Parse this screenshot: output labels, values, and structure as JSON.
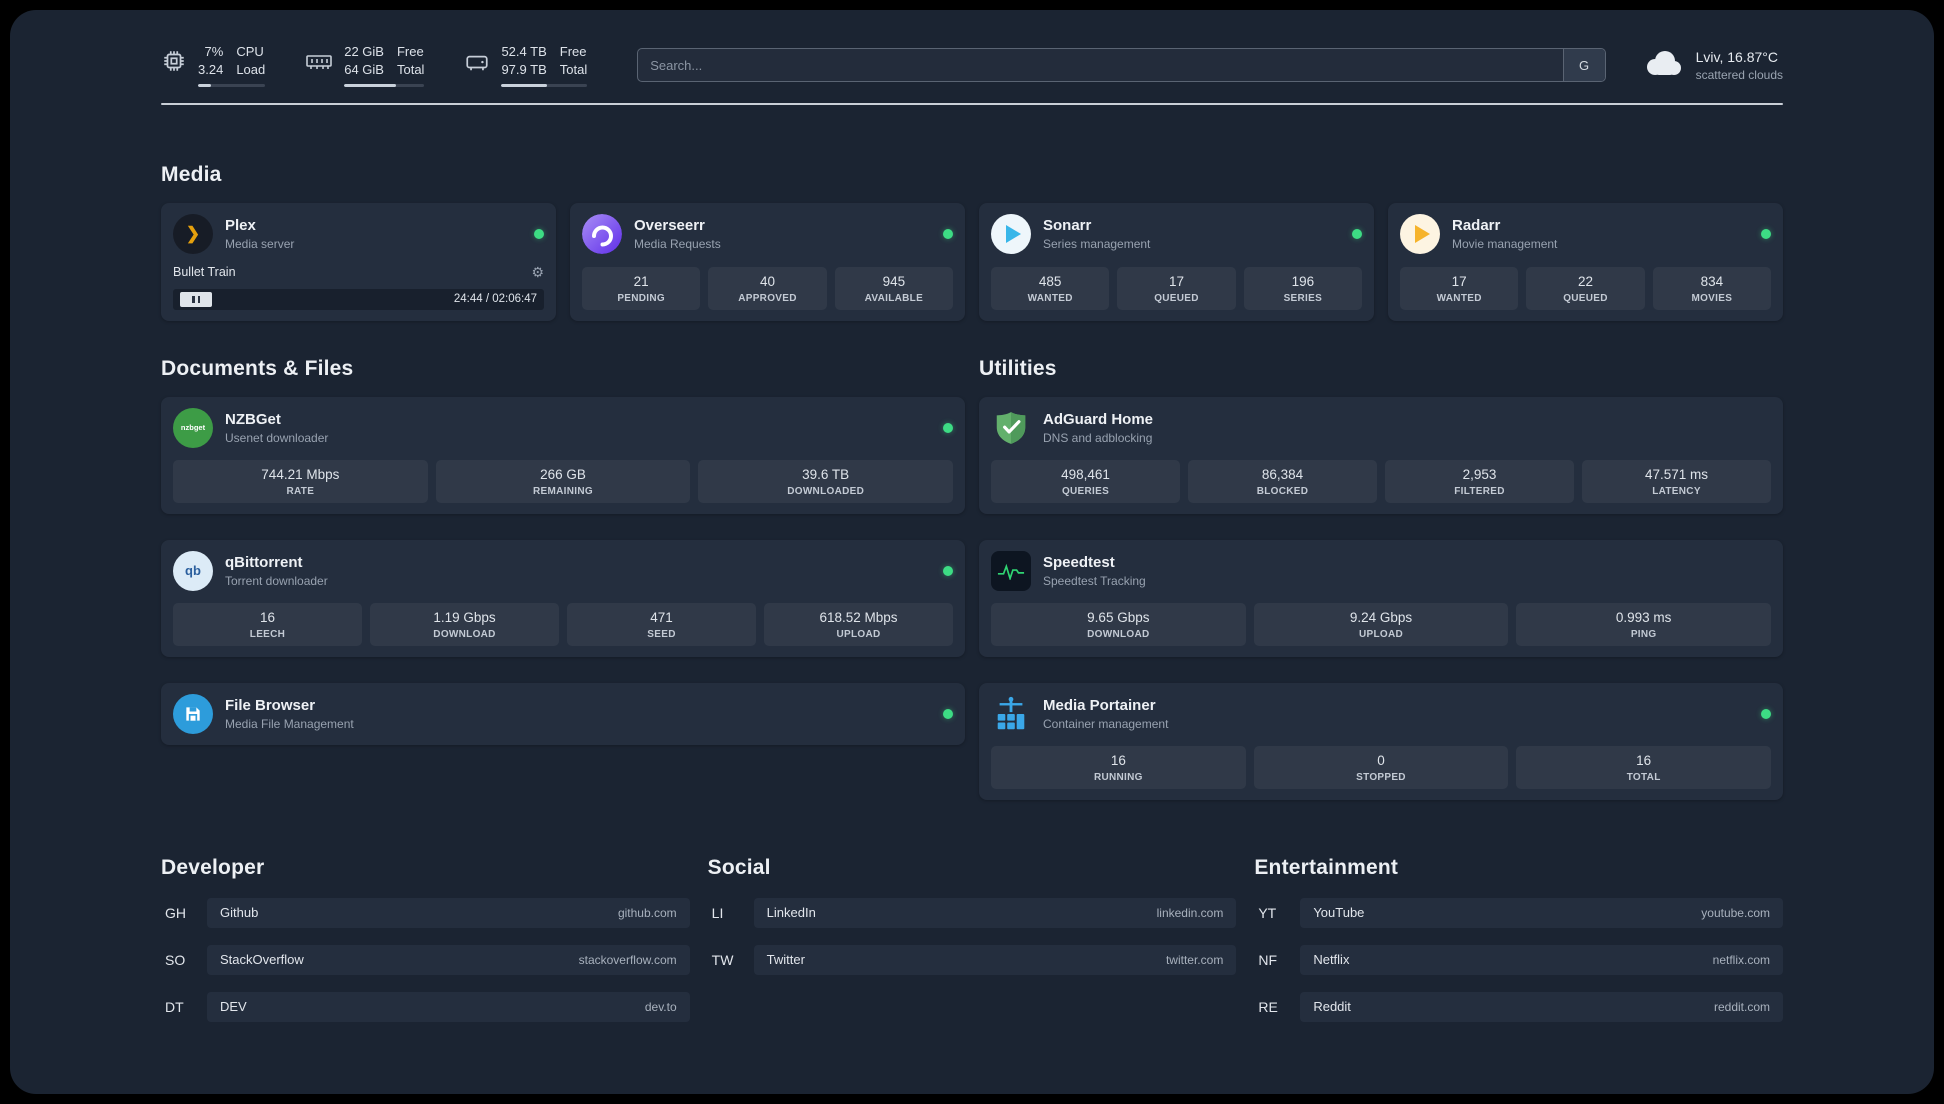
{
  "colors": {
    "background": "#1b2432",
    "card": "#242e3e",
    "status_online": "#3ddc84",
    "plex_gold": "#e5a00d",
    "portainer_blue": "#3aa7e8",
    "adguard_green": "#63b06c",
    "speedtest_green": "#2fd573"
  },
  "topbar": {
    "cpu": {
      "value": "7%",
      "load": "3.24",
      "label1": "CPU",
      "label2": "Load",
      "bar_percent": 20
    },
    "memory": {
      "free": "22 GiB",
      "total": "64 GiB",
      "label1": "Free",
      "label2": "Total",
      "bar_percent": 65
    },
    "disk": {
      "free": "52.4 TB",
      "total": "97.9 TB",
      "label1": "Free",
      "label2": "Total",
      "bar_percent": 53
    },
    "search": {
      "placeholder": "Search...",
      "provider_button": "G"
    },
    "weather": {
      "location": "Lviv, 16.87°C",
      "condition": "scattered clouds"
    }
  },
  "media": {
    "title": "Media",
    "cards": [
      {
        "title": "Plex",
        "subtitle": "Media server",
        "online": true,
        "player": {
          "track": "Bullet Train",
          "time": "24:44 / 02:06:47"
        }
      },
      {
        "title": "Overseerr",
        "subtitle": "Media Requests",
        "online": true,
        "stats": [
          {
            "value": "21",
            "label": "PENDING"
          },
          {
            "value": "40",
            "label": "APPROVED"
          },
          {
            "value": "945",
            "label": "AVAILABLE"
          }
        ]
      },
      {
        "title": "Sonarr",
        "subtitle": "Series management",
        "online": true,
        "stats": [
          {
            "value": "485",
            "label": "WANTED"
          },
          {
            "value": "17",
            "label": "QUEUED"
          },
          {
            "value": "196",
            "label": "SERIES"
          }
        ]
      },
      {
        "title": "Radarr",
        "subtitle": "Movie management",
        "online": true,
        "stats": [
          {
            "value": "17",
            "label": "WANTED"
          },
          {
            "value": "22",
            "label": "QUEUED"
          },
          {
            "value": "834",
            "label": "MOVIES"
          }
        ]
      }
    ]
  },
  "documents": {
    "title": "Documents & Files",
    "cards": [
      {
        "title": "NZBGet",
        "subtitle": "Usenet downloader",
        "online": true,
        "stats": [
          {
            "value": "744.21 Mbps",
            "label": "RATE"
          },
          {
            "value": "266 GB",
            "label": "REMAINING"
          },
          {
            "value": "39.6 TB",
            "label": "DOWNLOADED"
          }
        ]
      },
      {
        "title": "qBittorrent",
        "subtitle": "Torrent downloader",
        "online": true,
        "stats": [
          {
            "value": "16",
            "label": "LEECH"
          },
          {
            "value": "1.19 Gbps",
            "label": "DOWNLOAD"
          },
          {
            "value": "471",
            "label": "SEED"
          },
          {
            "value": "618.52 Mbps",
            "label": "UPLOAD"
          }
        ]
      },
      {
        "title": "File Browser",
        "subtitle": "Media File Management",
        "online": true
      }
    ]
  },
  "utilities": {
    "title": "Utilities",
    "cards": [
      {
        "title": "AdGuard Home",
        "subtitle": "DNS and adblocking",
        "stats": [
          {
            "value": "498,461",
            "label": "QUERIES"
          },
          {
            "value": "86,384",
            "label": "BLOCKED"
          },
          {
            "value": "2,953",
            "label": "FILTERED"
          },
          {
            "value": "47.571 ms",
            "label": "LATENCY"
          }
        ]
      },
      {
        "title": "Speedtest",
        "subtitle": "Speedtest Tracking",
        "stats": [
          {
            "value": "9.65 Gbps",
            "label": "DOWNLOAD"
          },
          {
            "value": "9.24 Gbps",
            "label": "UPLOAD"
          },
          {
            "value": "0.993 ms",
            "label": "PING"
          }
        ]
      },
      {
        "title": "Media Portainer",
        "subtitle": "Container management",
        "online": true,
        "stats": [
          {
            "value": "16",
            "label": "RUNNING"
          },
          {
            "value": "0",
            "label": "STOPPED"
          },
          {
            "value": "16",
            "label": "TOTAL"
          }
        ]
      }
    ]
  },
  "bookmarks": {
    "groups": [
      {
        "title": "Developer",
        "items": [
          {
            "abbr": "GH",
            "name": "Github",
            "url": "github.com"
          },
          {
            "abbr": "SO",
            "name": "StackOverflow",
            "url": "stackoverflow.com"
          },
          {
            "abbr": "DT",
            "name": "DEV",
            "url": "dev.to"
          }
        ]
      },
      {
        "title": "Social",
        "items": [
          {
            "abbr": "LI",
            "name": "LinkedIn",
            "url": "linkedin.com"
          },
          {
            "abbr": "TW",
            "name": "Twitter",
            "url": "twitter.com"
          }
        ]
      },
      {
        "title": "Entertainment",
        "items": [
          {
            "abbr": "YT",
            "name": "YouTube",
            "url": "youtube.com"
          },
          {
            "abbr": "NF",
            "name": "Netflix",
            "url": "netflix.com"
          },
          {
            "abbr": "RE",
            "name": "Reddit",
            "url": "reddit.com"
          }
        ]
      }
    ]
  },
  "icons": {
    "plex": "❯",
    "gear": "⚙",
    "qbittorrent": "qb",
    "nzbget": "nzbget"
  }
}
